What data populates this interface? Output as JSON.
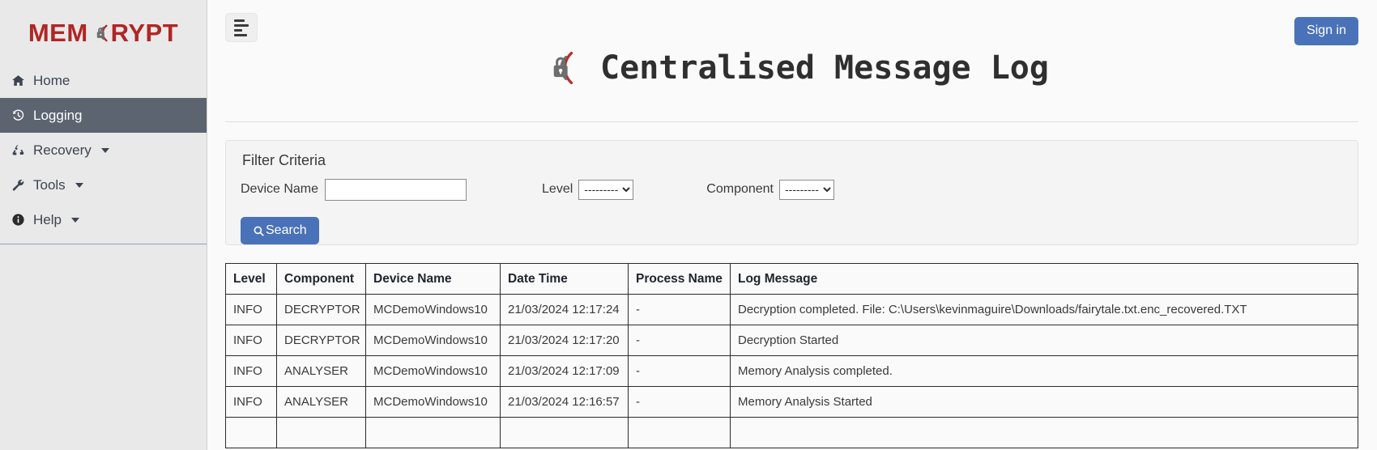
{
  "brand": {
    "text_before": "MEM",
    "text_after": "RYPT",
    "lock_icon": "lock-circle-icon"
  },
  "sidebar": {
    "items": [
      {
        "label": "Home",
        "icon": "home-icon",
        "active": false,
        "has_caret": false
      },
      {
        "label": "Logging",
        "icon": "history-icon",
        "active": true,
        "has_caret": false
      },
      {
        "label": "Recovery",
        "icon": "recycle-icon",
        "active": false,
        "has_caret": true
      },
      {
        "label": "Tools",
        "icon": "wrench-icon",
        "active": false,
        "has_caret": true
      },
      {
        "label": "Help",
        "icon": "info-icon",
        "active": false,
        "has_caret": true
      }
    ]
  },
  "topbar": {
    "menu_toggle_icon": "align-left-icon",
    "signin_label": "Sign in"
  },
  "header": {
    "title": "Centralised Message Log",
    "logo_icon": "lock-circle-icon"
  },
  "filter": {
    "title": "Filter Criteria",
    "device_label": "Device Name",
    "device_value": "",
    "device_placeholder": "",
    "level_label": "Level",
    "level_value": "---------",
    "level_options": [
      "---------"
    ],
    "component_label": "Component",
    "component_value": "---------",
    "component_options": [
      "---------"
    ],
    "search_label": "Search",
    "search_icon": "search-icon"
  },
  "table": {
    "columns": [
      "Level",
      "Component",
      "Device Name",
      "Date Time",
      "Process Name",
      "Log Message"
    ],
    "rows": [
      {
        "level": "INFO",
        "component": "DECRYPTOR",
        "device": "MCDemoWindows10",
        "datetime": "21/03/2024 12:17:24",
        "process": "-",
        "message": "Decryption completed. File: C:\\Users\\kevinmaguire\\Downloads/fairytale.txt.enc_recovered.TXT"
      },
      {
        "level": "INFO",
        "component": "DECRYPTOR",
        "device": "MCDemoWindows10",
        "datetime": "21/03/2024 12:17:20",
        "process": "-",
        "message": "Decryption Started"
      },
      {
        "level": "INFO",
        "component": "ANALYSER",
        "device": "MCDemoWindows10",
        "datetime": "21/03/2024 12:17:09",
        "process": "-",
        "message": "Memory Analysis completed."
      },
      {
        "level": "INFO",
        "component": "ANALYSER",
        "device": "MCDemoWindows10",
        "datetime": "21/03/2024 12:16:57",
        "process": "-",
        "message": "Memory Analysis Started"
      },
      {
        "level": "",
        "component": "",
        "device": "",
        "datetime": "",
        "process": "",
        "message": ""
      }
    ]
  },
  "colors": {
    "brand_red": "#b02626",
    "accent_blue": "#4a72b8",
    "sidebar_bg": "#e9e9e9",
    "active_nav": "#5c6470"
  }
}
